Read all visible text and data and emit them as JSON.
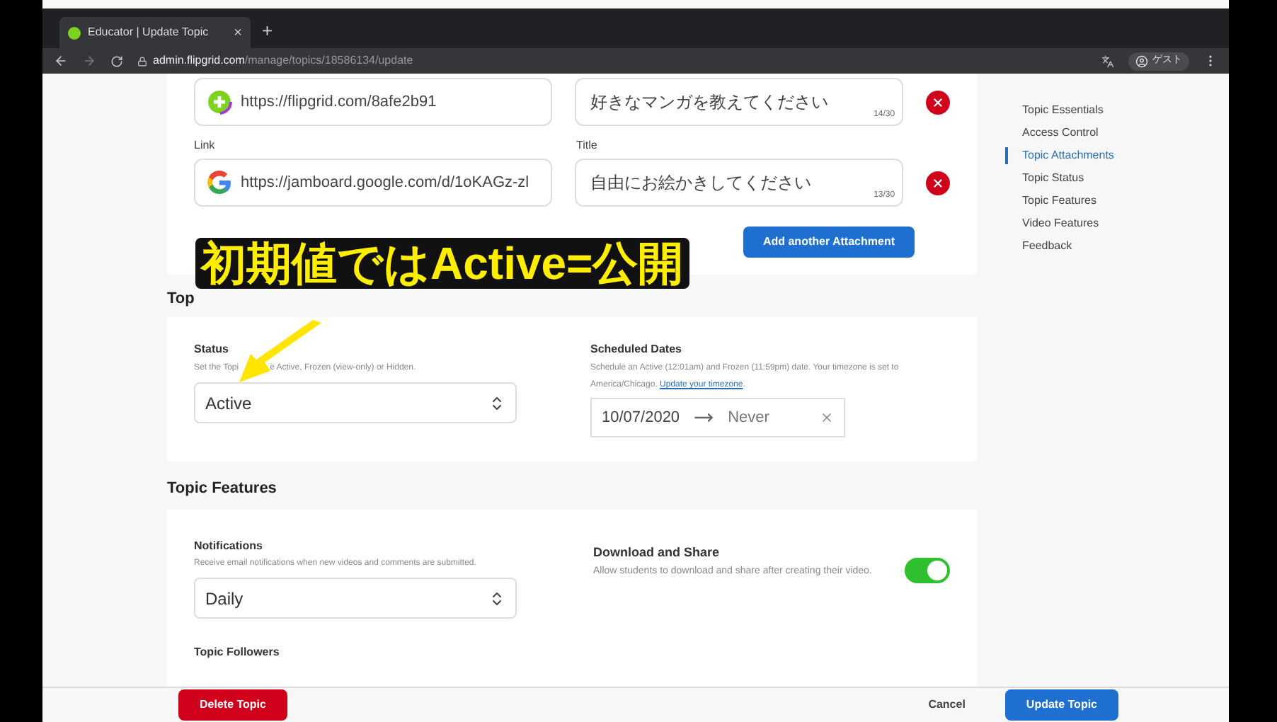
{
  "browser": {
    "tab_title": "Educator | Update Topic",
    "tab_close": "×",
    "new_tab": "+",
    "url_host": "admin.flipgrid.com",
    "url_path": "/manage/topics/18586134/update",
    "profile_label": "ゲスト"
  },
  "attachments": [
    {
      "kind": "flipgrid",
      "link": "https://flipgrid.com/8afe2b91",
      "title": "好きなマンガを教えてください",
      "count": "14/30"
    },
    {
      "kind": "google",
      "link_label": "Link",
      "title_label": "Title",
      "link": "https://jamboard.google.com/d/1oKAGz-zl",
      "title": "自由にお絵かきしてください",
      "count": "13/30"
    }
  ],
  "add_attachment": "Add another Attachment",
  "caption": "初期値ではActive=公開",
  "status_section": {
    "heading": "Top",
    "status_label": "Status",
    "status_desc_start": "Set the Topi",
    "status_desc_end": "e Active, Frozen (view-only) or Hidden.",
    "status_value": "Active",
    "dates_label": "Scheduled Dates",
    "dates_desc": "Schedule an Active (12:01am) and Frozen (11:59pm) date. Your timezone is set to America/Chicago.",
    "dates_link": "Update your timezone",
    "dates_end_punct": ".",
    "start_date": "10/07/2020",
    "end_date": "Never"
  },
  "features": {
    "heading": "Topic Features",
    "notifications_label": "Notifications",
    "notifications_desc": "Receive email notifications when new videos and comments are submitted.",
    "notifications_value": "Daily",
    "download_label": "Download and Share",
    "download_desc": "Allow students to download and share after creating their video.",
    "download_on": true,
    "followers_label": "Topic Followers"
  },
  "nav": [
    {
      "label": "Topic Essentials",
      "selected": false
    },
    {
      "label": "Access Control",
      "selected": false
    },
    {
      "label": "Topic Attachments",
      "selected": true
    },
    {
      "label": "Topic Status",
      "selected": false
    },
    {
      "label": "Topic Features",
      "selected": false
    },
    {
      "label": "Video Features",
      "selected": false
    },
    {
      "label": "Feedback",
      "selected": false
    }
  ],
  "footer": {
    "delete": "Delete Topic",
    "cancel": "Cancel",
    "update": "Update Topic"
  }
}
